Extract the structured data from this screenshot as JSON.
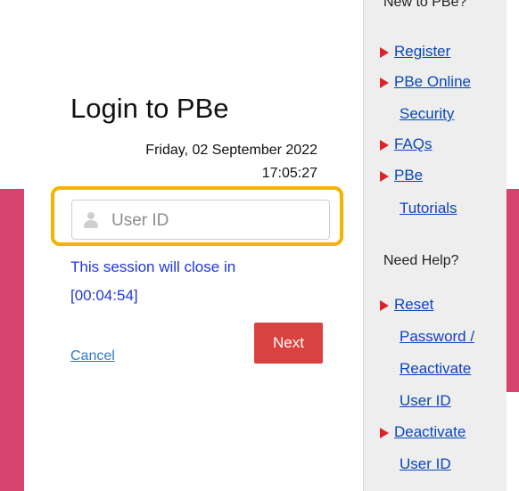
{
  "login": {
    "title": "Login to PBe",
    "date": "Friday, 02 September 2022",
    "time": "17:05:27",
    "userid_placeholder": "User ID",
    "session_line1": "This session will close in",
    "session_line2": "[00:04:54]",
    "cancel": "Cancel",
    "next": "Next"
  },
  "sidebar": {
    "new_heading": "New to PBe?",
    "items": [
      {
        "line1": "Register"
      },
      {
        "line1": "PBe Online",
        "line2": "Security"
      },
      {
        "line1": "FAQs"
      },
      {
        "line1": "PBe",
        "line2": "Tutorials"
      }
    ],
    "help_heading": "Need Help?",
    "help_items": [
      {
        "line1": "Reset",
        "line2": "Password /",
        "line3": "Reactivate",
        "line4": "User ID"
      },
      {
        "line1": "Deactivate",
        "line2": "User ID"
      }
    ]
  },
  "colors": {
    "accent_pink": "#d6436e",
    "highlight": "#f3b300",
    "next_button": "#d9423f",
    "link_blue": "#0a47b7",
    "arrow_red": "#d9242e"
  }
}
